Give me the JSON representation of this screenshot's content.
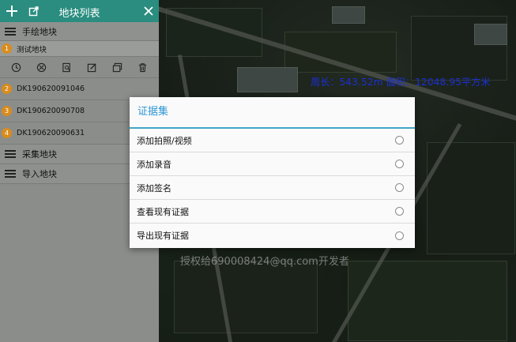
{
  "panel": {
    "title": "地块列表",
    "add_icon": "plus-icon",
    "export_icon": "share-icon",
    "close_icon": "close-icon",
    "groups": {
      "manual": "手绘地块",
      "collect": "采集地块",
      "import": "导入地块"
    },
    "manual_plots": [
      {
        "index": "1",
        "name": "测试地块"
      },
      {
        "index": "2",
        "name": "DK190620091046"
      },
      {
        "index": "3",
        "name": "DK190620090708"
      },
      {
        "index": "4",
        "name": "DK190620090631"
      }
    ],
    "tools": [
      "clock-icon",
      "location-icon",
      "search-doc-icon",
      "edit-icon",
      "layers-icon",
      "trash-icon"
    ]
  },
  "map": {
    "measure_text": "周长：543.52m  面积：12048.95平方米",
    "watermark": "授权给690008424@qq.com开发者"
  },
  "dialog": {
    "title": "证据集",
    "options": [
      "添加拍照/视频",
      "添加录音",
      "添加签名",
      "查看现有证据",
      "导出现有证据"
    ]
  },
  "colors": {
    "header": "#2a8d7f",
    "accent": "#2f96d5",
    "badge": "#d98c1d",
    "measure": "#1b2fd6"
  }
}
